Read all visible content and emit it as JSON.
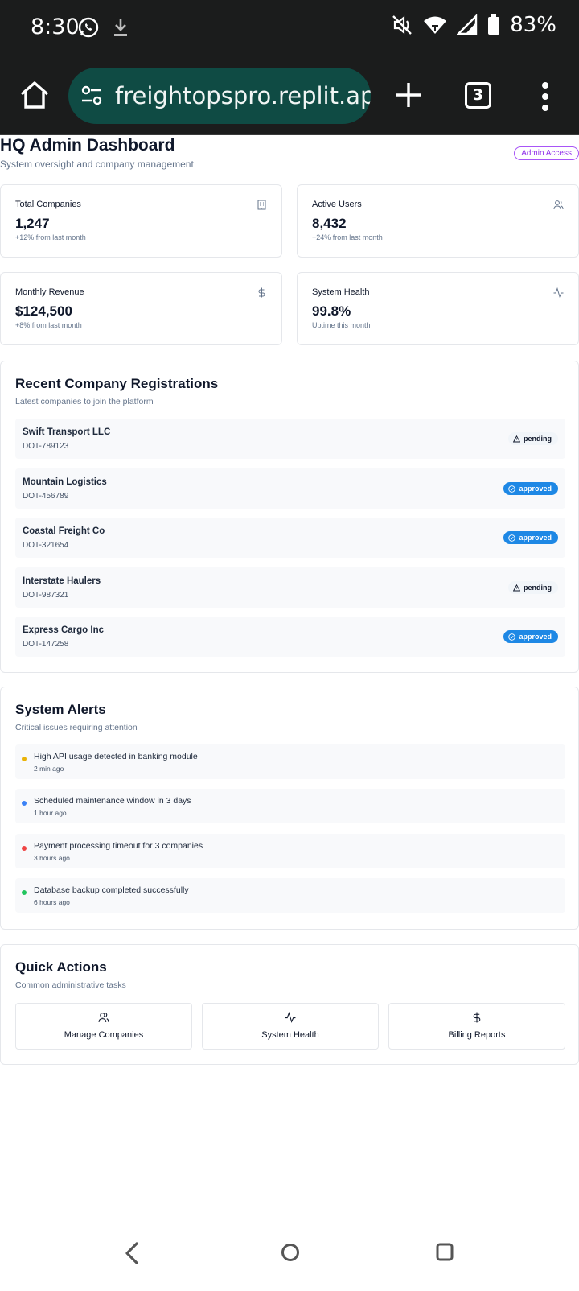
{
  "status_bar": {
    "time": "8:30",
    "battery": "83%",
    "icons": [
      "whatsapp-icon",
      "download-icon",
      "mute-icon",
      "wifi-icon",
      "signal-icon",
      "battery-icon"
    ]
  },
  "browser": {
    "url": "freightopspro.replit.app/",
    "tab_count": "3"
  },
  "header": {
    "title": "HQ Admin Dashboard",
    "subtitle": "System oversight and company management",
    "badge": "Admin Access"
  },
  "stats": [
    {
      "label": "Total Companies",
      "value": "1,247",
      "note": "+12% from last month",
      "icon": "building-icon"
    },
    {
      "label": "Active Users",
      "value": "8,432",
      "note": "+24% from last month",
      "icon": "users-icon"
    },
    {
      "label": "Monthly Revenue",
      "value": "$124,500",
      "note": "+8% from last month",
      "icon": "dollar-icon"
    },
    {
      "label": "System Health",
      "value": "99.8%",
      "note": "Uptime this month",
      "icon": "activity-icon"
    }
  ],
  "registrations": {
    "title": "Recent Company Registrations",
    "subtitle": "Latest companies to join the platform",
    "items": [
      {
        "name": "Swift Transport LLC",
        "dot": "DOT-789123",
        "status": "pending"
      },
      {
        "name": "Mountain Logistics",
        "dot": "DOT-456789",
        "status": "approved"
      },
      {
        "name": "Coastal Freight Co",
        "dot": "DOT-321654",
        "status": "approved"
      },
      {
        "name": "Interstate Haulers",
        "dot": "DOT-987321",
        "status": "pending"
      },
      {
        "name": "Express Cargo Inc",
        "dot": "DOT-147258",
        "status": "approved"
      }
    ]
  },
  "alerts": {
    "title": "System Alerts",
    "subtitle": "Critical issues requiring attention",
    "items": [
      {
        "text": "High API usage detected in banking module",
        "time": "2 min ago",
        "color": "#eab308"
      },
      {
        "text": "Scheduled maintenance window in 3 days",
        "time": "1 hour ago",
        "color": "#3b82f6"
      },
      {
        "text": "Payment processing timeout for 3 companies",
        "time": "3 hours ago",
        "color": "#ef4444"
      },
      {
        "text": "Database backup completed successfully",
        "time": "6 hours ago",
        "color": "#22c55e"
      }
    ]
  },
  "quick_actions": {
    "title": "Quick Actions",
    "subtitle": "Common administrative tasks",
    "items": [
      {
        "label": "Manage Companies",
        "icon": "users-icon"
      },
      {
        "label": "System Health",
        "icon": "activity-icon"
      },
      {
        "label": "Billing Reports",
        "icon": "dollar-icon"
      }
    ]
  },
  "colors": {
    "approved": "#1e88e5",
    "admin_badge": "#9333ea",
    "url_pill": "#0f4b44"
  }
}
